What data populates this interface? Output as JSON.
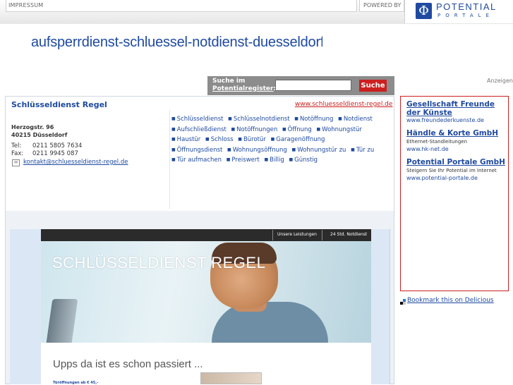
{
  "topbar": {
    "impressum": "IMPRESSUM",
    "powered_by": "POWERED BY",
    "logo_mark": "Φ",
    "logo_line1": "POTENTIAL",
    "logo_line2": "PORTALE"
  },
  "header": {
    "site_title": "aufsperrdienst-schluessel-notdienst-duesseldorf.de",
    "anzeigen": "Anzeigen"
  },
  "search": {
    "label_line1": "Suche im",
    "label_line2": "Potentialregister",
    "label_colon": ":",
    "input_value": "",
    "button": "Suche"
  },
  "company": {
    "name": "Schlüsseldienst Regel",
    "url": "www.schluesseldienst-regel.de",
    "street": "Herzogstr. 96",
    "city": "40215 Düsseldorf",
    "tel_label": "Tel:",
    "tel": "0211 5805 7634",
    "fax_label": "Fax:",
    "fax": "0211 9945 087",
    "email": "kontakt@schluesseldienst-regel.de"
  },
  "keywords": [
    "Schlüsseldienst",
    "Schlüsselnotdienst",
    "Notöffnung",
    "Notdienst",
    "Aufschließdienst",
    "Notöffnungen",
    "Öffnung",
    "Wohnungstür",
    "Haustür",
    "Schloss",
    "Bürotür",
    "Garagenöffnung",
    "Öffnungsdienst",
    "Wohnungsöffnung",
    "Wohnungstür zu",
    "Tür zu",
    "Tür aufmachen",
    "Preiswert",
    "Billig",
    "Günstig"
  ],
  "screenshot": {
    "nav_1": "Unsere Leistungen",
    "nav_2": "24 Std. Notdienst",
    "hero_title": "SCHLÜSSELDIENST REGEL",
    "heading": "Upps da ist es schon passiert ...",
    "tiny_text": "Türöffnungen ab € 45,-"
  },
  "ads": [
    {
      "title": "Gesellschaft Freunde der Künste",
      "desc": "",
      "url": "www.freundederkuenste.de"
    },
    {
      "title": "Händle & Korte GmbH",
      "desc": "Ethernet-Standleitungen",
      "url": "www.hk-net.de"
    },
    {
      "title": "Potential Portale GmbH",
      "desc": "Steigern Sie Ihr Potential im Internet",
      "url": "www.potential-portale.de"
    }
  ],
  "delicious": {
    "label": "Bookmark this on Delicious",
    "colors": [
      "#3274d1",
      "#000000",
      "#cccccc",
      "#ffffff"
    ]
  },
  "colors": {
    "brand_blue": "#1f4aa0",
    "accent_red": "#cc1f1f",
    "search_panel": "#8c8c8c"
  }
}
